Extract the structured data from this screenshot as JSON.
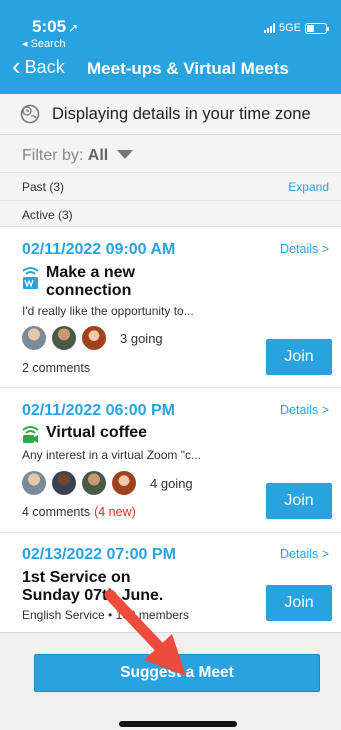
{
  "status_bar": {
    "time": "5:05",
    "location_glyph": "↗",
    "back_label": "◂ Search",
    "network": "5GE"
  },
  "nav": {
    "back_label": "Back",
    "title": "Meet-ups & Virtual Meets"
  },
  "timezone": {
    "icon": "clock-globe-icon",
    "text": "Displaying details in your time zone"
  },
  "filter": {
    "label": "Filter by:",
    "value": "All"
  },
  "sections": {
    "past": "Past (3)",
    "expand": "Expand",
    "active": "Active (3)"
  },
  "meets": [
    {
      "date": "02/11/2022 09:00 AM",
      "details": "Details >",
      "title": "Make a new connection",
      "icon": "wifi-wave-icon",
      "description": "I'd really like the opportunity to...",
      "going": "3 going",
      "comments": "2 comments",
      "new_comments": "",
      "join": "Join"
    },
    {
      "date": "02/11/2022 06:00 PM",
      "details": "Details >",
      "title": "Virtual coffee",
      "icon": "video-call-icon",
      "description": "Any interest in a virtual Zoom \"c...",
      "going": "4 going",
      "comments": "4 comments",
      "new_comments": "(4 new)",
      "join": "Join"
    },
    {
      "date": "02/13/2022 07:00 PM",
      "details": "Details >",
      "title": "1st Service on Sunday 07th June.",
      "icon": "",
      "description": "English Service • 100 members",
      "join": "Join"
    }
  ],
  "bottom": {
    "suggest": "Suggest a Meet"
  },
  "colors": {
    "accent": "#29a3e0",
    "alert": "#e0301e",
    "arrow": "#ee4b3c"
  }
}
